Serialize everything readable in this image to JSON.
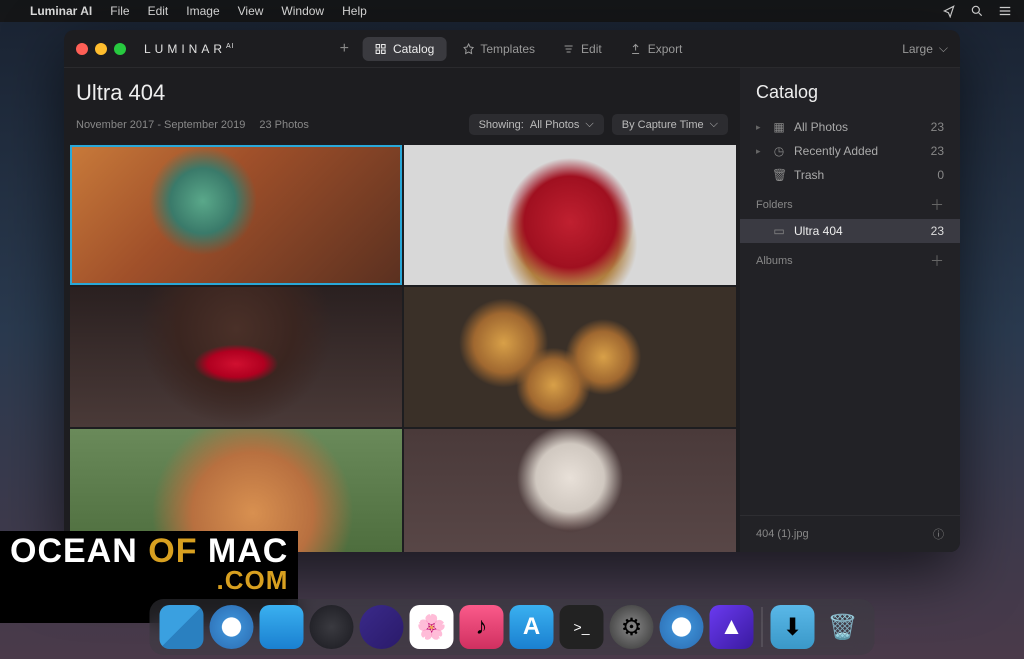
{
  "menubar": {
    "app": "Luminar AI",
    "items": [
      "File",
      "Edit",
      "Image",
      "View",
      "Window",
      "Help"
    ]
  },
  "window": {
    "logo_main": "LUMINAR",
    "logo_sup": "AI",
    "tabs": {
      "catalog": "Catalog",
      "templates": "Templates",
      "edit": "Edit",
      "export": "Export"
    },
    "size_label": "Large"
  },
  "main": {
    "title": "Ultra 404",
    "date_range": "November 2017 - September 2019",
    "photo_count": "23 Photos",
    "filter_showing_prefix": "Showing:",
    "filter_showing_value": "All Photos",
    "filter_sort": "By Capture Time"
  },
  "sidebar": {
    "title": "Catalog",
    "shortcuts": [
      {
        "icon": "grid",
        "label": "All Photos",
        "count": "23"
      },
      {
        "icon": "clock",
        "label": "Recently Added",
        "count": "23"
      },
      {
        "icon": "trash",
        "label": "Trash",
        "count": "0"
      }
    ],
    "folders_label": "Folders",
    "folders": [
      {
        "label": "Ultra 404",
        "count": "23",
        "selected": true
      }
    ],
    "albums_label": "Albums",
    "footer_filename": "404 (1).jpg"
  },
  "watermark": {
    "w1": "OCEAN",
    "w2": "OF",
    "w3": "MAC",
    "w4": ".COM"
  },
  "dock_items": [
    "finder",
    "safari",
    "store",
    "dark1",
    "dark2",
    "photos",
    "music",
    "appstore",
    "terminal",
    "settings",
    "safari2",
    "luminar",
    "folder",
    "trash"
  ]
}
